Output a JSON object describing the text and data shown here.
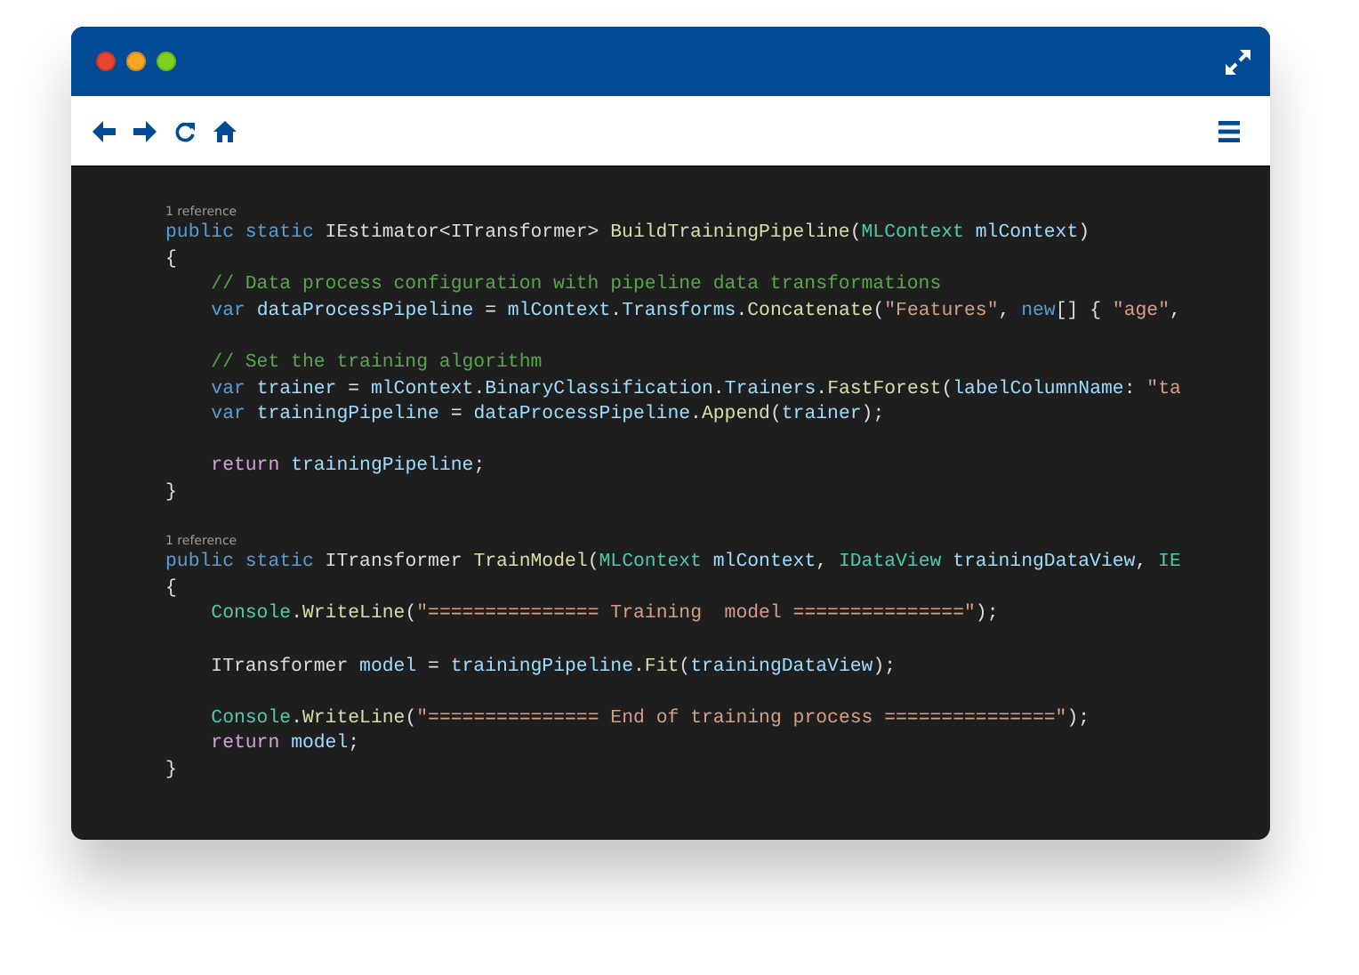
{
  "code_lines": [
    {
      "kind": "reference",
      "text": "1 reference"
    },
    {
      "kind": "code",
      "tokens": [
        {
          "kind": "kw",
          "text": "public static "
        },
        {
          "kind": "plain",
          "text": "IEstimator<ITransformer> "
        },
        {
          "kind": "method",
          "text": "BuildTrainingPipeline"
        },
        {
          "kind": "plain",
          "text": "("
        },
        {
          "kind": "type",
          "text": "MLContext "
        },
        {
          "kind": "ident",
          "text": "mlContext"
        },
        {
          "kind": "plain",
          "text": ")"
        }
      ]
    },
    {
      "kind": "code",
      "tokens": [
        {
          "kind": "plain",
          "text": "{"
        }
      ]
    },
    {
      "kind": "code",
      "tokens": [
        {
          "kind": "comment",
          "text": "    // Data process configuration with pipeline data transformations"
        }
      ]
    },
    {
      "kind": "code",
      "tokens": [
        {
          "kind": "kw",
          "text": "    var "
        },
        {
          "kind": "ident",
          "text": "dataProcessPipeline"
        },
        {
          "kind": "plain",
          "text": " = "
        },
        {
          "kind": "ident",
          "text": "mlContext"
        },
        {
          "kind": "plain",
          "text": "."
        },
        {
          "kind": "ident",
          "text": "Transforms"
        },
        {
          "kind": "plain",
          "text": "."
        },
        {
          "kind": "method",
          "text": "Concatenate"
        },
        {
          "kind": "plain",
          "text": "("
        },
        {
          "kind": "string",
          "text": "\"Features\""
        },
        {
          "kind": "plain",
          "text": ", "
        },
        {
          "kind": "kw",
          "text": "new"
        },
        {
          "kind": "plain",
          "text": "[] { "
        },
        {
          "kind": "string",
          "text": "\"age\""
        },
        {
          "kind": "plain",
          "text": ","
        }
      ]
    },
    {
      "kind": "blank"
    },
    {
      "kind": "code",
      "tokens": [
        {
          "kind": "comment",
          "text": "    // Set the training algorithm"
        }
      ]
    },
    {
      "kind": "code",
      "tokens": [
        {
          "kind": "kw",
          "text": "    var "
        },
        {
          "kind": "ident",
          "text": "trainer"
        },
        {
          "kind": "plain",
          "text": " = "
        },
        {
          "kind": "ident",
          "text": "mlContext"
        },
        {
          "kind": "plain",
          "text": "."
        },
        {
          "kind": "ident",
          "text": "BinaryClassification"
        },
        {
          "kind": "plain",
          "text": "."
        },
        {
          "kind": "ident",
          "text": "Trainers"
        },
        {
          "kind": "plain",
          "text": "."
        },
        {
          "kind": "method",
          "text": "FastForest"
        },
        {
          "kind": "plain",
          "text": "("
        },
        {
          "kind": "ident",
          "text": "labelColumnName"
        },
        {
          "kind": "plain",
          "text": ": "
        },
        {
          "kind": "string",
          "text": "\"ta"
        }
      ]
    },
    {
      "kind": "code",
      "tokens": [
        {
          "kind": "kw",
          "text": "    var "
        },
        {
          "kind": "ident",
          "text": "trainingPipeline"
        },
        {
          "kind": "plain",
          "text": " = "
        },
        {
          "kind": "ident",
          "text": "dataProcessPipeline"
        },
        {
          "kind": "plain",
          "text": "."
        },
        {
          "kind": "method",
          "text": "Append"
        },
        {
          "kind": "plain",
          "text": "("
        },
        {
          "kind": "ident",
          "text": "trainer"
        },
        {
          "kind": "plain",
          "text": ");"
        }
      ]
    },
    {
      "kind": "blank"
    },
    {
      "kind": "code",
      "tokens": [
        {
          "kind": "control",
          "text": "    return "
        },
        {
          "kind": "ident",
          "text": "trainingPipeline"
        },
        {
          "kind": "plain",
          "text": ";"
        }
      ]
    },
    {
      "kind": "code",
      "tokens": [
        {
          "kind": "plain",
          "text": "}"
        }
      ]
    },
    {
      "kind": "blank"
    },
    {
      "kind": "reference",
      "text": "1 reference"
    },
    {
      "kind": "code",
      "tokens": [
        {
          "kind": "kw",
          "text": "public static "
        },
        {
          "kind": "plain",
          "text": "ITransformer "
        },
        {
          "kind": "method",
          "text": "TrainModel"
        },
        {
          "kind": "plain",
          "text": "("
        },
        {
          "kind": "type",
          "text": "MLContext "
        },
        {
          "kind": "ident",
          "text": "mlContext"
        },
        {
          "kind": "plain",
          "text": ", "
        },
        {
          "kind": "type",
          "text": "IDataView "
        },
        {
          "kind": "ident",
          "text": "trainingDataView"
        },
        {
          "kind": "plain",
          "text": ", "
        },
        {
          "kind": "type",
          "text": "IE"
        }
      ]
    },
    {
      "kind": "code",
      "tokens": [
        {
          "kind": "plain",
          "text": "{"
        }
      ]
    },
    {
      "kind": "code",
      "tokens": [
        {
          "kind": "type",
          "text": "    Console"
        },
        {
          "kind": "plain",
          "text": "."
        },
        {
          "kind": "method",
          "text": "WriteLine"
        },
        {
          "kind": "plain",
          "text": "("
        },
        {
          "kind": "string",
          "text": "\"=============== Training  model ===============\""
        },
        {
          "kind": "plain",
          "text": ");"
        }
      ]
    },
    {
      "kind": "blank"
    },
    {
      "kind": "code",
      "tokens": [
        {
          "kind": "plain",
          "text": "    ITransformer "
        },
        {
          "kind": "ident",
          "text": "model"
        },
        {
          "kind": "plain",
          "text": " = "
        },
        {
          "kind": "ident",
          "text": "trainingPipeline"
        },
        {
          "kind": "plain",
          "text": "."
        },
        {
          "kind": "method",
          "text": "Fit"
        },
        {
          "kind": "plain",
          "text": "("
        },
        {
          "kind": "ident",
          "text": "trainingDataView"
        },
        {
          "kind": "plain",
          "text": ");"
        }
      ]
    },
    {
      "kind": "blank"
    },
    {
      "kind": "code",
      "tokens": [
        {
          "kind": "type",
          "text": "    Console"
        },
        {
          "kind": "plain",
          "text": "."
        },
        {
          "kind": "method",
          "text": "WriteLine"
        },
        {
          "kind": "plain",
          "text": "("
        },
        {
          "kind": "string",
          "text": "\"=============== End of training process ===============\""
        },
        {
          "kind": "plain",
          "text": ");"
        }
      ]
    },
    {
      "kind": "code",
      "tokens": [
        {
          "kind": "control",
          "text": "    return "
        },
        {
          "kind": "ident",
          "text": "model"
        },
        {
          "kind": "plain",
          "text": ";"
        }
      ]
    },
    {
      "kind": "code",
      "tokens": [
        {
          "kind": "plain",
          "text": "}"
        }
      ]
    }
  ]
}
